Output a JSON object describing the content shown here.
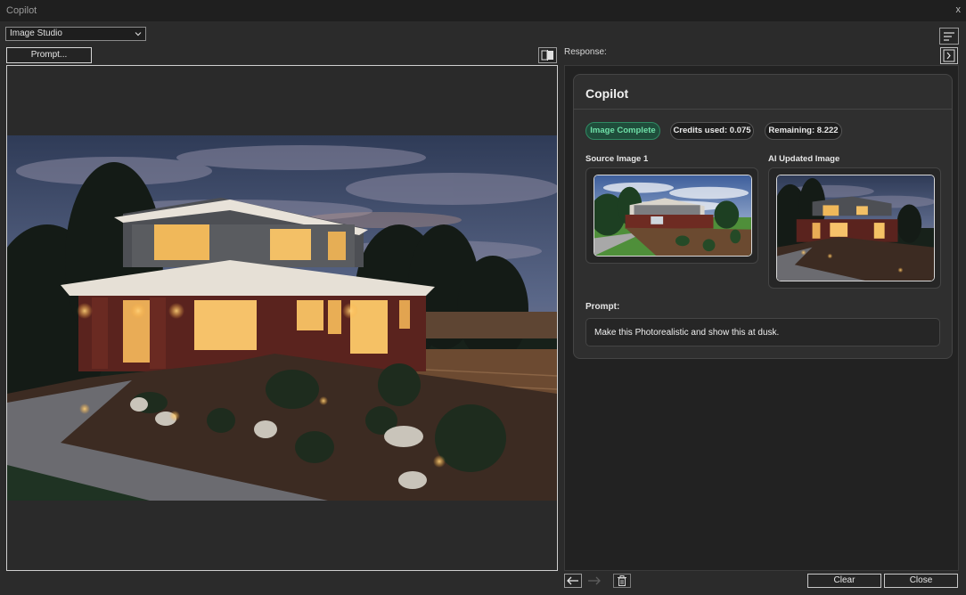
{
  "window": {
    "title": "Copilot",
    "close_glyph": "x"
  },
  "toolbar": {
    "mode_select": "Image Studio",
    "prompt_button": "Prompt...",
    "response_label": "Response:"
  },
  "copilot_card": {
    "title": "Copilot",
    "status_badge": "Image Complete",
    "credits_used": "Credits used: 0.075",
    "remaining": "Remaining: 8.222",
    "source_label": "Source Image 1",
    "updated_label": "AI Updated Image",
    "prompt_label": "Prompt:",
    "prompt_text": "Make this Photorealistic and show this at dusk."
  },
  "footer": {
    "clear_button": "Clear",
    "close_button": "Close"
  },
  "icons": {
    "dropdown": "chevron-down-icon",
    "swap": "compare-icon",
    "menu": "menu-icon",
    "expand": "expand-panel-icon",
    "back": "arrow-left-icon",
    "forward": "arrow-right-icon",
    "trash": "trash-icon"
  },
  "colors": {
    "status_green": "#6fe0a8",
    "status_bg": "#1f4d3b",
    "window_bg": "#2b2b2b"
  }
}
